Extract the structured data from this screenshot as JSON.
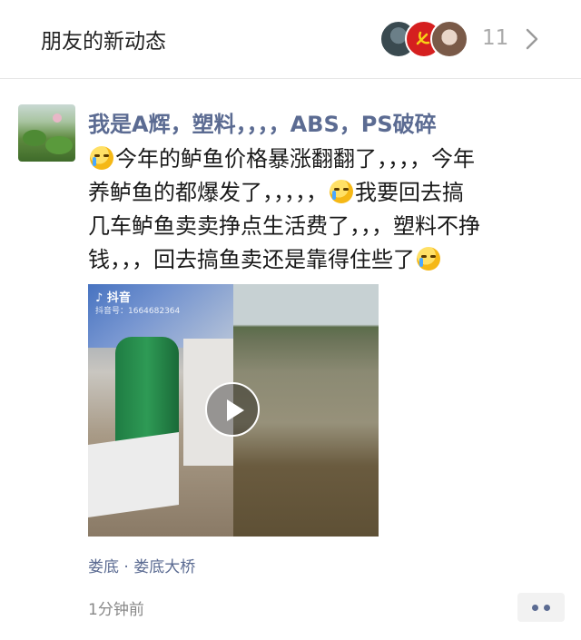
{
  "header": {
    "title": "朋友的新动态",
    "count": "11"
  },
  "post": {
    "username": "我是A辉，塑料，，，，ABS，PS破碎",
    "text_lines": [
      "今年的鲈鱼价格暴涨翻翻了，，，，今年",
      "养鲈鱼的都爆发了，，，，，",
      "我要回去搞",
      "几车鲈鱼卖卖挣点生活费了，，，塑料不挣",
      "钱，，，回去搞鱼卖还是靠得住些了"
    ],
    "video": {
      "watermark_app": "抖音",
      "watermark_id": "抖音号：1664682364"
    },
    "location": "娄底 · 娄底大桥",
    "time": "1分钟前"
  },
  "colors": {
    "link": "#5b6b92",
    "muted": "#888888"
  }
}
